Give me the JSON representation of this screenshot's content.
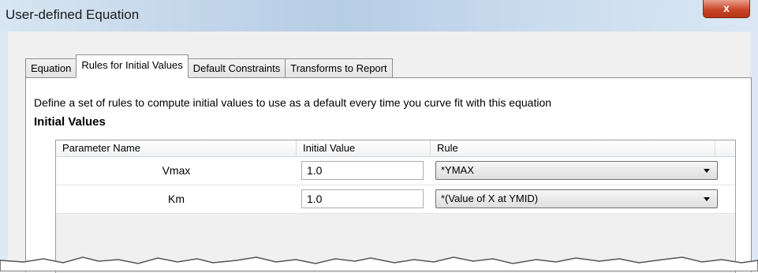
{
  "window": {
    "title": "User-defined Equation",
    "close_label": "x"
  },
  "tabs": [
    {
      "label": "Equation",
      "active": false
    },
    {
      "label": "Rules for Initial Values",
      "active": true
    },
    {
      "label": "Default Constraints",
      "active": false
    },
    {
      "label": "Transforms to Report",
      "active": false
    }
  ],
  "panel": {
    "description": "Define a set of rules to compute initial values to use as a default every time you curve fit with this equation",
    "section_title": "Initial Values"
  },
  "grid": {
    "columns": [
      "Parameter Name",
      "Initial Value",
      "Rule"
    ],
    "rows": [
      {
        "name": "Vmax",
        "initial_value": "1.0",
        "rule": "*YMAX"
      },
      {
        "name": "Km",
        "initial_value": "1.0",
        "rule": "*(Value of X at YMID)"
      }
    ]
  },
  "colors": {
    "title_bar": "#c7d9ec",
    "close_button": "#c9462a",
    "dialog_bg": "#f0f0f0"
  }
}
